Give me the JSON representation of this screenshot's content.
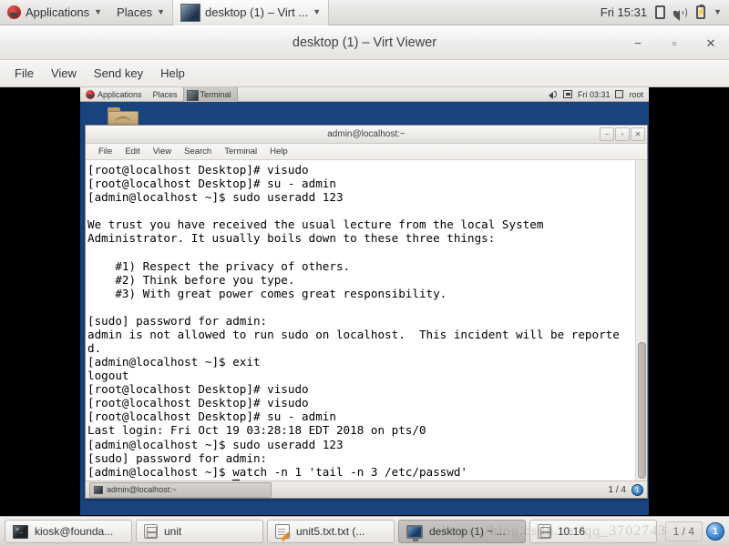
{
  "host_panel": {
    "logo_icon": "fedora-logo-icon",
    "applications_label": "Applications",
    "places_label": "Places",
    "window_task_label": "desktop (1) – Virt ...",
    "clock": "Fri 15:31",
    "icons": [
      "display-icon",
      "volume-icon",
      "battery-icon",
      "chevron-down-icon"
    ]
  },
  "virt_viewer": {
    "title": "desktop (1) – Virt Viewer",
    "controls": {
      "minimize": "−",
      "maximize": "▫",
      "close": "✕"
    },
    "menus": [
      "File",
      "View",
      "Send key",
      "Help"
    ]
  },
  "guest_panel": {
    "applications_label": "Applications",
    "places_label": "Places",
    "window_task_label": "Terminal",
    "clock": "Fri 03:31",
    "user": "root"
  },
  "guest_desktop": {
    "folder_icon": "folder-icon"
  },
  "terminal": {
    "title": "admin@localhost:~",
    "controls": {
      "minimize": "−",
      "maximize": "▫",
      "close": "✕"
    },
    "menus": [
      "File",
      "Edit",
      "View",
      "Search",
      "Terminal",
      "Help"
    ],
    "content": "[root@localhost Desktop]# visudo\n[root@localhost Desktop]# su - admin\n[admin@localhost ~]$ sudo useradd 123\n\nWe trust you have received the usual lecture from the local System\nAdministrator. It usually boils down to these three things:\n\n    #1) Respect the privacy of others.\n    #2) Think before you type.\n    #3) With great power comes great responsibility.\n\n[sudo] password for admin:\nadmin is not allowed to run sudo on localhost.  This incident will be reporte\nd.\n[admin@localhost ~]$ exit\nlogout\n[root@localhost Desktop]# visudo\n[root@localhost Desktop]# visudo\n[root@localhost Desktop]# su - admin\nLast login: Fri Oct 19 03:28:18 EDT 2018 on pts/0\n[admin@localhost ~]$ sudo useradd 123\n[sudo] password for admin:\n[admin@localhost ~]$ watch -n 1 'tail -n 3 /etc/passwd'\n[admin@localhost ~]$ ",
    "statusbar": {
      "tab_label": "admin@localhost:~",
      "page_indicator": "1 / 4",
      "workspace_badge": "1"
    }
  },
  "host_taskbar": {
    "items": [
      {
        "label": "kiosk@founda...",
        "icon": "terminal-icon",
        "active": false
      },
      {
        "label": "unit",
        "icon": "archive-icon",
        "active": false
      },
      {
        "label": "unit5.txt.txt (...",
        "icon": "text-editor-icon",
        "active": false
      },
      {
        "label": "desktop (1) ~ ...",
        "icon": "monitor-icon",
        "active": true
      },
      {
        "label": "10.16",
        "icon": "archive-icon",
        "active": false
      }
    ],
    "page_indicator": "1 / 4",
    "workspace_badge": "1"
  },
  "watermark": {
    "text": "https://blog.csdn.net/qq_3702743"
  },
  "colors": {
    "guest_desktop_bg": "#1a4480",
    "panel_bg": "#e4e2e0",
    "terminal_bg": "#ffffff",
    "terminal_fg": "#000000",
    "accent_blue": "#4a90d9"
  }
}
